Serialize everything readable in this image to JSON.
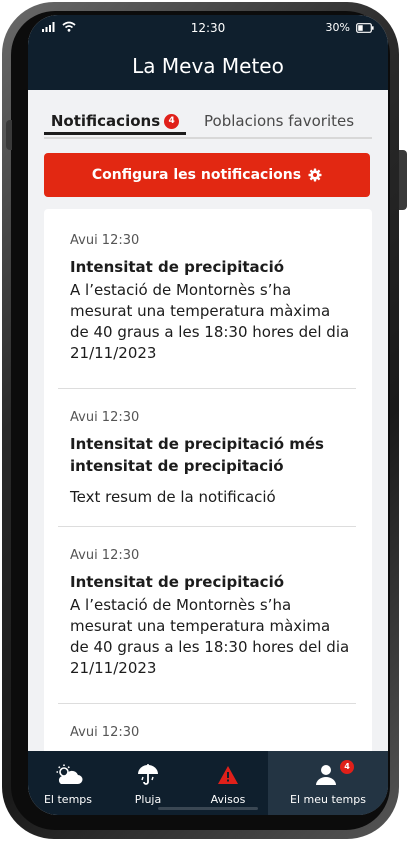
{
  "status_bar": {
    "time": "12:30",
    "battery": "30%"
  },
  "app": {
    "title": "La Meva Meteo"
  },
  "tabs": {
    "notifications": {
      "label": "Notificacions",
      "badge": "4"
    },
    "favorites": {
      "label": "Poblacions favorites"
    }
  },
  "configure_button": {
    "label": "Configura les notificacions",
    "icon": "gear-icon"
  },
  "notifications": [
    {
      "time": "Avui 12:30",
      "title": "Intensitat de precipitació",
      "body": "A l’estació de Montornès s’ha mesurat una temperatura màxima de 40 graus a les 18:30 hores del dia 21/11/2023"
    },
    {
      "time": "Avui 12:30",
      "title": "Intensitat de precipitació més intensitat de precipitació",
      "body": "Text resum de la notificació"
    },
    {
      "time": "Avui 12:30",
      "title": "Intensitat de precipitació",
      "body": "A l’estació de Montornès s’ha mesurat una temperatura màxima de 40 graus a les 18:30 hores del dia 21/11/2023"
    },
    {
      "time": "Avui 12:30",
      "title": "",
      "body": ""
    }
  ],
  "bottom_nav": [
    {
      "label": "El temps",
      "icon": "sun-cloud-icon"
    },
    {
      "label": "Pluja",
      "icon": "umbrella-icon"
    },
    {
      "label": "Avisos",
      "icon": "warning-icon"
    },
    {
      "label": "El meu temps",
      "icon": "user-icon",
      "badge": "4",
      "active": true
    }
  ],
  "colors": {
    "primary_dark": "#0f1f2d",
    "accent_red": "#e22812",
    "badge_red": "#e0201a"
  }
}
